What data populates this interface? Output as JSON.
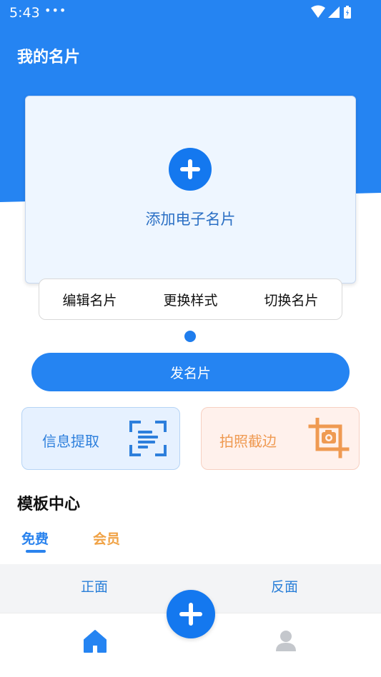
{
  "status_bar": {
    "time": "5:43",
    "dots": "•••"
  },
  "header": {
    "title": "我的名片"
  },
  "card": {
    "add_label": "添加电子名片"
  },
  "actions": {
    "edit": "编辑名片",
    "style": "更换样式",
    "switch": "切换名片"
  },
  "send_button": "发名片",
  "features": {
    "extract": "信息提取",
    "crop": "拍照截边"
  },
  "templates": {
    "title": "模板中心",
    "tabs": {
      "free": "免费",
      "vip": "会员"
    },
    "faces": {
      "front": "正面",
      "back": "反面"
    }
  },
  "colors": {
    "primary": "#2584f2",
    "accent_orange": "#ef9a52",
    "card_bg": "#eef6ff"
  },
  "icons": {
    "card_add": "plus-icon",
    "extract": "scan-text-icon",
    "crop": "crop-camera-icon",
    "nav_home": "home-icon",
    "nav_fab": "plus-icon",
    "nav_user": "user-icon"
  }
}
